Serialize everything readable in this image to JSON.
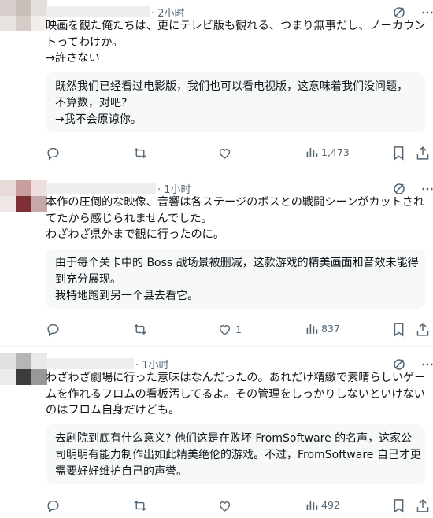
{
  "posts": [
    {
      "time": "· 2小时",
      "body_lines": [
        "映画を観た俺たちは、更にテレビ版も観れる、つまり無事だし、ノーカウン",
        "トってわけか。",
        "→許さない"
      ],
      "translation_lines": [
        "既然我们已经看过电影版，我们也可以看电视版，这意味着我们没问题，",
        "不算数，对吧?",
        "→我不会原谅你。"
      ],
      "likes": "",
      "views": "1,473"
    },
    {
      "time": "· 1小时",
      "body_lines": [
        "本作の圧倒的な映像、音響は各ステージのボスとの戦闘シーンがカットされ",
        "てたから感じられませんでした。",
        "わざわざ県外まで観に行ったのに。"
      ],
      "translation_lines": [
        "由于每个关卡中的 Boss 战场景被删减，这款游戏的精美画面和音效未能得",
        "到充分展现。",
        "我特地跑到另一个县去看它。"
      ],
      "likes": "1",
      "views": "837"
    },
    {
      "time": "· 1小时",
      "body_lines": [
        "わざわざ劇場に行った意味はなんだったの。あれだけ精緻で素晴らしいゲー",
        "ムを作れるフロムの看板汚してるよ。その管理をしっかりしないといけない",
        "のはフロム自身だけども。"
      ],
      "translation_lines": [
        "去剧院到底有什么意义? 他们这是在败坏 FromSoftware 的名声，这家公",
        "司明明有能力制作出如此精美绝伦的游戏。不过，FromSoftware 自己才更",
        "需要好好维护自己的声誉。"
      ],
      "likes": "",
      "views": "492"
    }
  ],
  "icons": {
    "reply": "reply-icon",
    "repost": "repost-icon",
    "like": "heart-icon",
    "views": "views-bar-icon",
    "bookmark": "bookmark-icon",
    "share": "share-icon",
    "grok": "grok-icon",
    "more": "more-icon"
  },
  "colors": {
    "text": "#0f1419",
    "muted": "#536471",
    "translation_bg": "#f7f9f9",
    "separator": "#eff3f4"
  }
}
